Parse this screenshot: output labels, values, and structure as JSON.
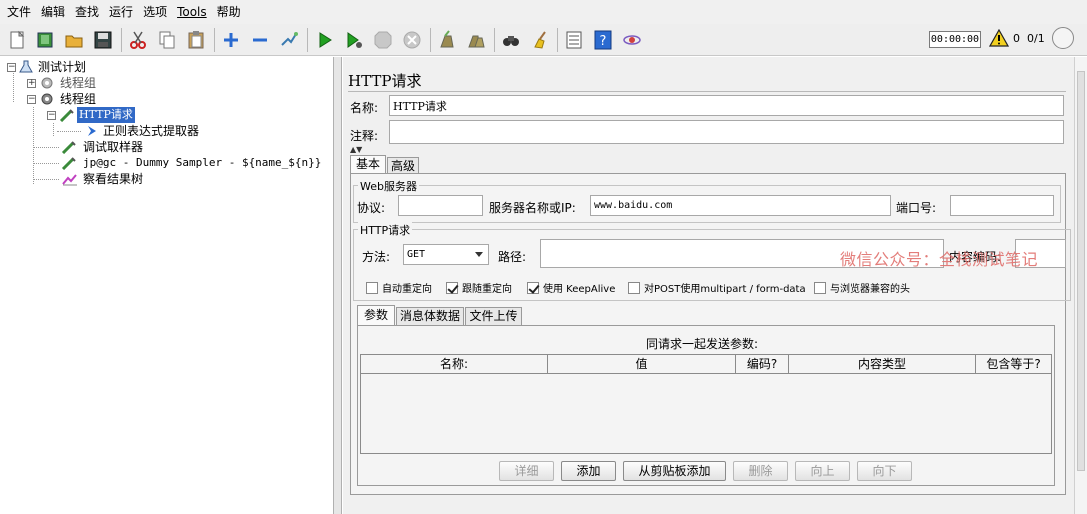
{
  "menu": [
    "文件",
    "编辑",
    "查找",
    "运行",
    "选项",
    "Tools",
    "帮助"
  ],
  "toolbar": {
    "icons": [
      "new-icon",
      "templates-icon",
      "open-icon",
      "save-icon",
      "cut-icon",
      "copy-icon",
      "paste-icon",
      "expand-icon",
      "collapse-icon",
      "toggle-icon",
      "start-icon",
      "start-no-pause-icon",
      "stop-icon",
      "shutdown-icon",
      "clear-icon",
      "clear-all-icon",
      "search-icon",
      "reset-search-icon",
      "function-helper-icon",
      "help-icon",
      "remote-icon"
    ],
    "timer": "00:00:00",
    "error_count": "0",
    "thread_count": "0/1"
  },
  "tree": {
    "nodes": [
      {
        "label": "测试计划"
      },
      {
        "label": "线程组"
      },
      {
        "label": "线程组"
      },
      {
        "label": "HTTP请求"
      },
      {
        "label": "正则表达式提取器"
      },
      {
        "label": "调试取样器"
      },
      {
        "label": "jp@gc - Dummy Sampler - ${name_${n}}"
      },
      {
        "label": "察看结果树"
      }
    ]
  },
  "form": {
    "title": "HTTP请求",
    "name_label": "名称:",
    "name_value": "HTTP请求",
    "comment_label": "注释:",
    "comment_value": "",
    "tabs": [
      "基本",
      "高级"
    ],
    "web_server": {
      "group_title": "Web服务器",
      "protocol_label": "协议:",
      "protocol_value": "",
      "server_label": "服务器名称或IP:",
      "server_value": "www.baidu.com",
      "port_label": "端口号:",
      "port_value": ""
    },
    "http_request": {
      "group_title": "HTTP请求",
      "method_label": "方法:",
      "method_value": "GET",
      "path_label": "路径:",
      "path_value": "",
      "content_encoding_label": "内容编码:",
      "checkboxes": [
        {
          "label": "自动重定向",
          "checked": false
        },
        {
          "label": "跟随重定向",
          "checked": true
        },
        {
          "label": "使用 KeepAlive",
          "checked": true
        },
        {
          "label": "对POST使用multipart / form-data",
          "checked": false
        },
        {
          "label": "与浏览器兼容的头",
          "checked": false
        }
      ]
    },
    "sub_tabs": [
      "参数",
      "消息体数据",
      "文件上传"
    ],
    "params_heading": "同请求一起发送参数:",
    "columns": [
      "名称:",
      "值",
      "编码?",
      "内容类型",
      "包含等于?"
    ],
    "buttons": [
      {
        "label": "详细",
        "enabled": false
      },
      {
        "label": "添加",
        "enabled": true
      },
      {
        "label": "从剪贴板添加",
        "enabled": true
      },
      {
        "label": "删除",
        "enabled": false
      },
      {
        "label": "向上",
        "enabled": false
      },
      {
        "label": "向下",
        "enabled": false
      }
    ]
  },
  "watermark": "微信公众号：全栈测试笔记"
}
